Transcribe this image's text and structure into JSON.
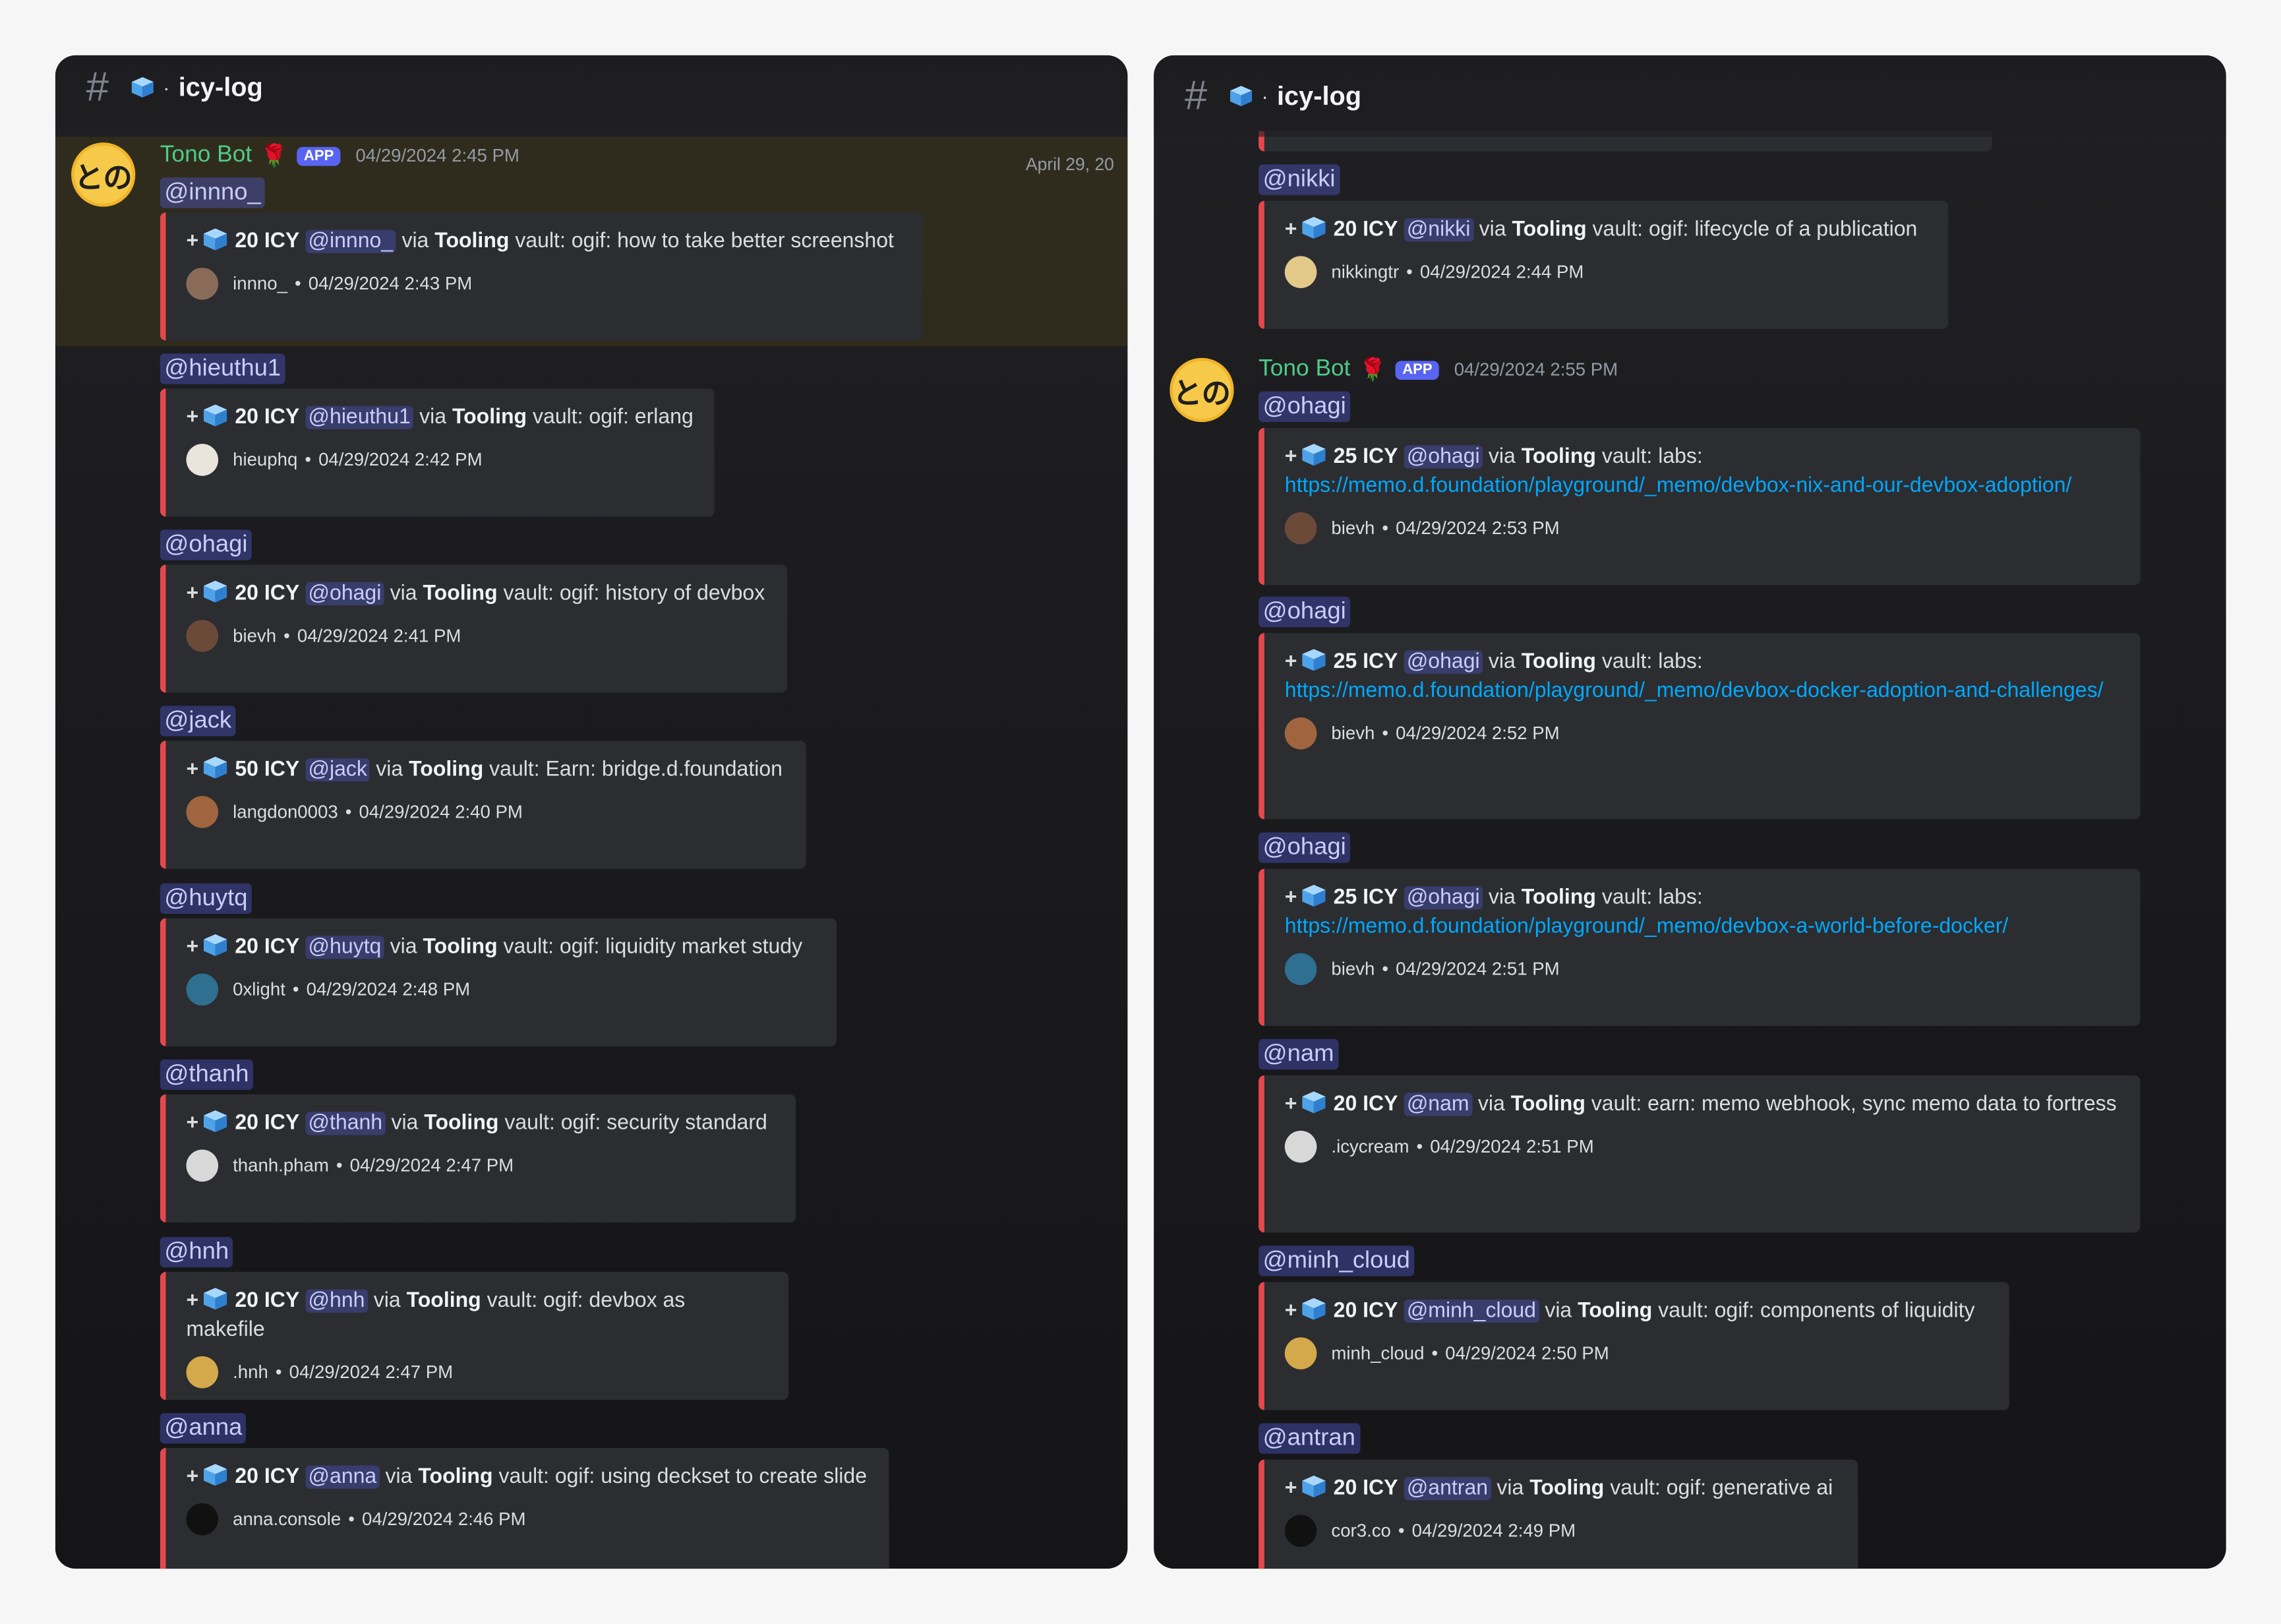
{
  "channel": {
    "name": "icy-log",
    "separator": "·"
  },
  "date_hint": "April 29, 20",
  "bot": {
    "name": "Tono Bot",
    "badge": "APP",
    "avatar_text": "との",
    "emoji": "🌹"
  },
  "left_panel": {
    "bot_timestamp": "04/29/2024 2:45 PM",
    "messages": [
      {
        "mention": "@innno_",
        "amount": "20 ICY",
        "user_mention": "@innno_",
        "via": "via",
        "vault": "Tooling",
        "description": "vault: ogif: how to take better screenshot",
        "author": "innno_",
        "time": "04/29/2024 2:43 PM"
      },
      {
        "mention": "@hieuthu1",
        "amount": "20 ICY",
        "user_mention": "@hieuthu1",
        "via": "via",
        "vault": "Tooling",
        "description": "vault: ogif: erlang",
        "author": "hieuphq",
        "time": "04/29/2024 2:42 PM"
      },
      {
        "mention": "@ohagi",
        "amount": "20 ICY",
        "user_mention": "@ohagi",
        "via": "via",
        "vault": "Tooling",
        "description": "vault: ogif: history of devbox",
        "author": "bievh",
        "time": "04/29/2024 2:41 PM"
      },
      {
        "mention": "@jack",
        "amount": "50 ICY",
        "user_mention": "@jack",
        "via": "via",
        "vault": "Tooling",
        "description": "vault: Earn: bridge.d.foundation",
        "author": "langdon0003",
        "time": "04/29/2024 2:40 PM"
      },
      {
        "mention": "@huytq",
        "amount": "20 ICY",
        "user_mention": "@huytq",
        "via": "via",
        "vault": "Tooling",
        "description": "vault: ogif: liquidity market study",
        "author": "0xlight",
        "time": "04/29/2024 2:48 PM"
      },
      {
        "mention": "@thanh",
        "amount": "20 ICY",
        "user_mention": "@thanh",
        "via": "via",
        "vault": "Tooling",
        "description": "vault: ogif: security standard",
        "author": "thanh.pham",
        "time": "04/29/2024 2:47 PM"
      },
      {
        "mention": "@hnh",
        "amount": "20 ICY",
        "user_mention": "@hnh",
        "via": "via",
        "vault": "Tooling",
        "description": "vault: ogif: devbox as makefile",
        "author": ".hnh",
        "time": "04/29/2024 2:47 PM"
      },
      {
        "mention": "@anna",
        "amount": "20 ICY",
        "user_mention": "@anna",
        "via": "via",
        "vault": "Tooling",
        "description": "vault: ogif: using deckset to create slide",
        "author": "anna.console",
        "time": "04/29/2024 2:46 PM"
      }
    ]
  },
  "right_panel": {
    "bot_timestamp": "04/29/2024 2:55 PM",
    "top_message": {
      "mention": "@nikki",
      "amount": "20 ICY",
      "user_mention": "@nikki",
      "via": "via",
      "vault": "Tooling",
      "description": "vault: ogif: lifecycle of a publication",
      "author": "nikkingtr",
      "time": "04/29/2024 2:44 PM"
    },
    "messages": [
      {
        "mention": "@ohagi",
        "amount": "25 ICY",
        "user_mention": "@ohagi",
        "via": "via",
        "vault": "Tooling",
        "description": "vault: labs:",
        "link": "https://memo.d.foundation/playground/_memo/devbox-nix-and-our-devbox-adoption/",
        "author": "bievh",
        "time": "04/29/2024 2:53 PM"
      },
      {
        "mention": "@ohagi",
        "amount": "25 ICY",
        "user_mention": "@ohagi",
        "via": "via",
        "vault": "Tooling",
        "description": "vault: labs:",
        "link": "https://memo.d.foundation/playground/_memo/devbox-docker-adoption-and-challenges/",
        "author": "bievh",
        "time": "04/29/2024 2:52 PM"
      },
      {
        "mention": "@ohagi",
        "amount": "25 ICY",
        "user_mention": "@ohagi",
        "via": "via",
        "vault": "Tooling",
        "description": "vault: labs:",
        "link": "https://memo.d.foundation/playground/_memo/devbox-a-world-before-docker/",
        "author": "bievh",
        "time": "04/29/2024 2:51 PM"
      },
      {
        "mention": "@nam",
        "amount": "20 ICY",
        "user_mention": "@nam",
        "via": "via",
        "vault": "Tooling",
        "description": "vault: earn: memo webhook, sync memo data to fortress",
        "author": ".icycream",
        "time": "04/29/2024 2:51 PM"
      },
      {
        "mention": "@minh_cloud",
        "amount": "20 ICY",
        "user_mention": "@minh_cloud",
        "via": "via",
        "vault": "Tooling",
        "description": "vault: ogif: components of liquidity",
        "author": "minh_cloud",
        "time": "04/29/2024 2:50 PM"
      },
      {
        "mention": "@antran",
        "amount": "20 ICY",
        "user_mention": "@antran",
        "via": "via",
        "vault": "Tooling",
        "description": "vault: ogif: generative ai",
        "author": "cor3.co",
        "time": "04/29/2024 2:49 PM"
      }
    ]
  },
  "colors": {
    "accent": "#e4484d",
    "bot_name": "#4fcc86",
    "mention_bg": "#5865f2",
    "link": "#00a8fc"
  },
  "icons": {
    "channel": "hash-icon",
    "coin": "ice-cube-icon"
  }
}
